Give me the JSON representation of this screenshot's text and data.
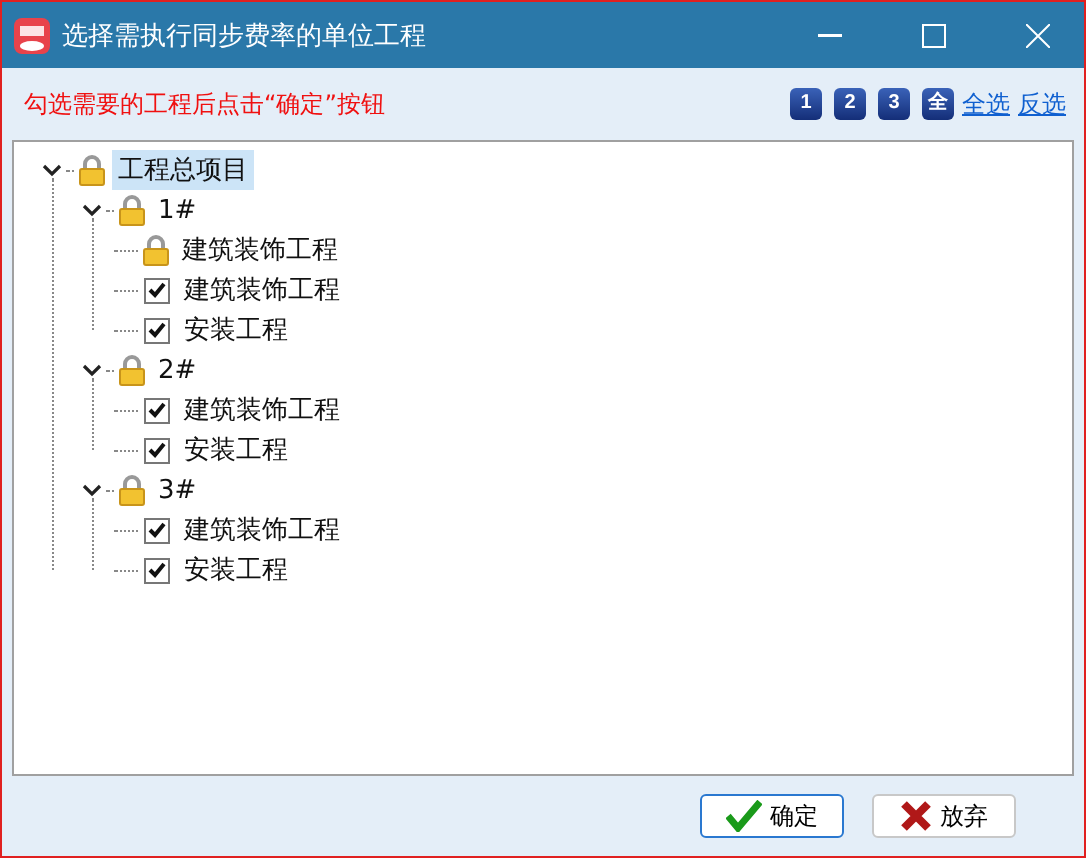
{
  "window": {
    "title": "选择需执行同步费率的单位工程"
  },
  "hint": "勾选需要的工程后点击“确定”按钮",
  "level_buttons": [
    "1",
    "2",
    "3",
    "全"
  ],
  "links": [
    "全选",
    "反选"
  ],
  "tree": [
    {
      "label": "工程总项目",
      "kind": "lock",
      "selected": true,
      "expanded": true,
      "children": [
        {
          "label": "1#",
          "kind": "lock",
          "selected": false,
          "expanded": true,
          "children": [
            {
              "label": "建筑装饰工程",
              "kind": "lock",
              "selected": false
            },
            {
              "label": "建筑装饰工程",
              "kind": "check",
              "checked": true,
              "selected": false
            },
            {
              "label": "安装工程",
              "kind": "check",
              "checked": true,
              "selected": false
            }
          ]
        },
        {
          "label": "2#",
          "kind": "lock",
          "selected": false,
          "expanded": true,
          "children": [
            {
              "label": "建筑装饰工程",
              "kind": "check",
              "checked": true,
              "selected": false
            },
            {
              "label": "安装工程",
              "kind": "check",
              "checked": true,
              "selected": false
            }
          ]
        },
        {
          "label": "3#",
          "kind": "lock",
          "selected": false,
          "expanded": true,
          "children": [
            {
              "label": "建筑装饰工程",
              "kind": "check",
              "checked": true,
              "selected": false
            },
            {
              "label": "安装工程",
              "kind": "check",
              "checked": true,
              "selected": false
            }
          ]
        }
      ]
    }
  ],
  "buttons": [
    {
      "label": "确定",
      "kind": "ok",
      "focused": true
    },
    {
      "label": "放弃",
      "kind": "cancel",
      "focused": false
    }
  ]
}
